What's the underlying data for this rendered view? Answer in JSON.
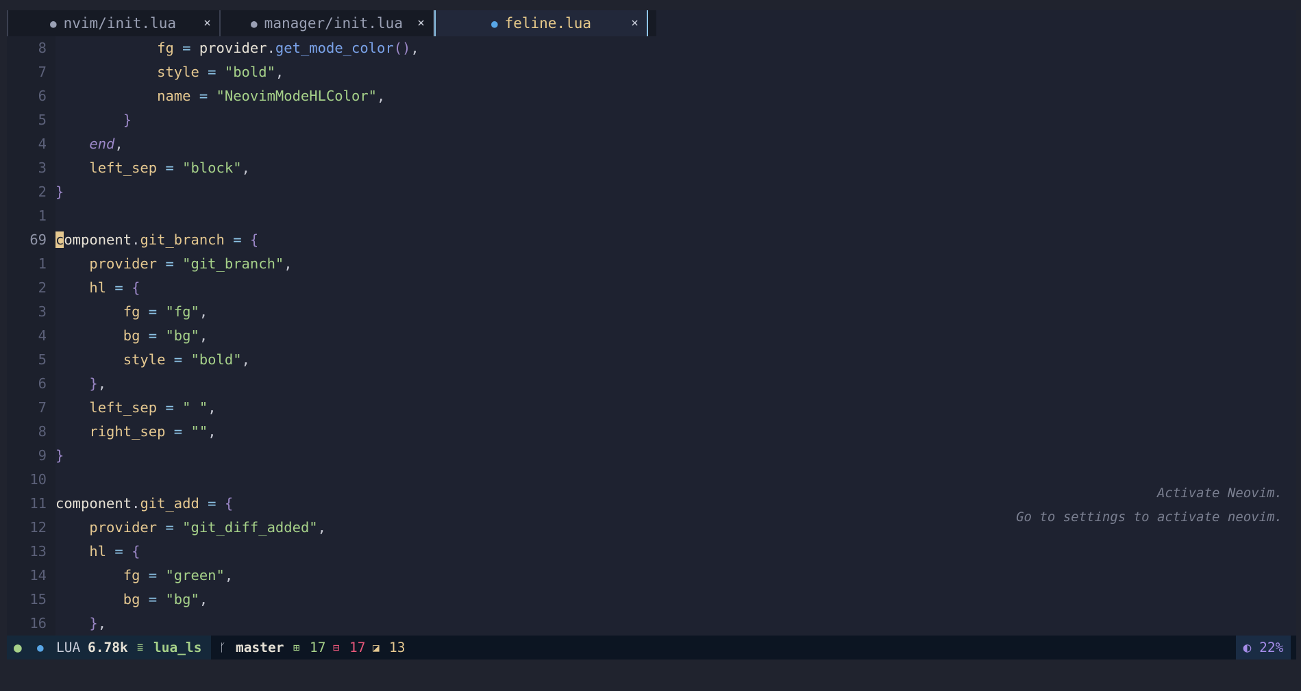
{
  "tabs": [
    {
      "label": "nvim/init.lua",
      "close": "×"
    },
    {
      "label": "manager/init.lua",
      "close": "×"
    },
    {
      "label": "feline.lua",
      "close": "×"
    }
  ],
  "active_tab_index": 2,
  "lines": [
    {
      "num": "8",
      "tokens": [
        [
          "            ",
          "k-id"
        ],
        [
          "fg",
          "k-key"
        ],
        [
          " = ",
          "k-op"
        ],
        [
          "provider",
          "k-id"
        ],
        [
          ".",
          "k-pn"
        ],
        [
          "get_mode_color",
          "k-fn"
        ],
        [
          "()",
          "k-br"
        ],
        [
          ",",
          "k-pn"
        ]
      ]
    },
    {
      "num": "7",
      "tokens": [
        [
          "            ",
          "k-id"
        ],
        [
          "style",
          "k-key"
        ],
        [
          " = ",
          "k-op"
        ],
        [
          "\"bold\"",
          "k-str"
        ],
        [
          ",",
          "k-pn"
        ]
      ]
    },
    {
      "num": "6",
      "tokens": [
        [
          "            ",
          "k-id"
        ],
        [
          "name",
          "k-key"
        ],
        [
          " = ",
          "k-op"
        ],
        [
          "\"NeovimModeHLColor\"",
          "k-str"
        ],
        [
          ",",
          "k-pn"
        ]
      ]
    },
    {
      "num": "5",
      "tokens": [
        [
          "        ",
          "k-id"
        ],
        [
          "}",
          "k-br"
        ]
      ]
    },
    {
      "num": "4",
      "tokens": [
        [
          "    ",
          "k-id"
        ],
        [
          "end",
          "k-kw"
        ],
        [
          ",",
          "k-pn"
        ]
      ]
    },
    {
      "num": "3",
      "tokens": [
        [
          "    ",
          "k-id"
        ],
        [
          "left_sep",
          "k-key"
        ],
        [
          " = ",
          "k-op"
        ],
        [
          "\"block\"",
          "k-str"
        ],
        [
          ",",
          "k-pn"
        ]
      ]
    },
    {
      "num": "2",
      "tokens": [
        [
          "}",
          "k-br"
        ]
      ]
    },
    {
      "num": "1",
      "tokens": []
    },
    {
      "num": "69",
      "current": true,
      "tokens": [
        [
          "c",
          "cursor"
        ],
        [
          "omponent",
          "k-id"
        ],
        [
          ".",
          "k-pn"
        ],
        [
          "git_branch",
          "k-key"
        ],
        [
          " = ",
          "k-op"
        ],
        [
          "{",
          "k-br"
        ]
      ]
    },
    {
      "num": "1",
      "tokens": [
        [
          "    ",
          "k-id"
        ],
        [
          "provider",
          "k-key"
        ],
        [
          " = ",
          "k-op"
        ],
        [
          "\"git_branch\"",
          "k-str"
        ],
        [
          ",",
          "k-pn"
        ]
      ]
    },
    {
      "num": "2",
      "tokens": [
        [
          "    ",
          "k-id"
        ],
        [
          "hl",
          "k-key"
        ],
        [
          " = ",
          "k-op"
        ],
        [
          "{",
          "k-br"
        ]
      ]
    },
    {
      "num": "3",
      "tokens": [
        [
          "        ",
          "k-id"
        ],
        [
          "fg",
          "k-key"
        ],
        [
          " = ",
          "k-op"
        ],
        [
          "\"fg\"",
          "k-str"
        ],
        [
          ",",
          "k-pn"
        ]
      ]
    },
    {
      "num": "4",
      "tokens": [
        [
          "        ",
          "k-id"
        ],
        [
          "bg",
          "k-key"
        ],
        [
          " = ",
          "k-op"
        ],
        [
          "\"bg\"",
          "k-str"
        ],
        [
          ",",
          "k-pn"
        ]
      ]
    },
    {
      "num": "5",
      "tokens": [
        [
          "        ",
          "k-id"
        ],
        [
          "style",
          "k-key"
        ],
        [
          " = ",
          "k-op"
        ],
        [
          "\"bold\"",
          "k-str"
        ],
        [
          ",",
          "k-pn"
        ]
      ]
    },
    {
      "num": "6",
      "tokens": [
        [
          "    ",
          "k-id"
        ],
        [
          "}",
          "k-br"
        ],
        [
          ",",
          "k-pn"
        ]
      ]
    },
    {
      "num": "7",
      "tokens": [
        [
          "    ",
          "k-id"
        ],
        [
          "left_sep",
          "k-key"
        ],
        [
          " = ",
          "k-op"
        ],
        [
          "\" \"",
          "k-str"
        ],
        [
          ",",
          "k-pn"
        ]
      ]
    },
    {
      "num": "8",
      "tokens": [
        [
          "    ",
          "k-id"
        ],
        [
          "right_sep",
          "k-key"
        ],
        [
          " = ",
          "k-op"
        ],
        [
          "\"\"",
          "k-str"
        ],
        [
          ",",
          "k-pn"
        ]
      ]
    },
    {
      "num": "9",
      "tokens": [
        [
          "}",
          "k-br"
        ]
      ]
    },
    {
      "num": "10",
      "tokens": []
    },
    {
      "num": "11",
      "tokens": [
        [
          "component",
          "k-id"
        ],
        [
          ".",
          "k-pn"
        ],
        [
          "git_add",
          "k-key"
        ],
        [
          " = ",
          "k-op"
        ],
        [
          "{",
          "k-br"
        ]
      ]
    },
    {
      "num": "12",
      "tokens": [
        [
          "    ",
          "k-id"
        ],
        [
          "provider",
          "k-key"
        ],
        [
          " = ",
          "k-op"
        ],
        [
          "\"git_diff_added\"",
          "k-str"
        ],
        [
          ",",
          "k-pn"
        ]
      ]
    },
    {
      "num": "13",
      "tokens": [
        [
          "    ",
          "k-id"
        ],
        [
          "hl",
          "k-key"
        ],
        [
          " = ",
          "k-op"
        ],
        [
          "{",
          "k-br"
        ]
      ]
    },
    {
      "num": "14",
      "tokens": [
        [
          "        ",
          "k-id"
        ],
        [
          "fg",
          "k-key"
        ],
        [
          " = ",
          "k-op"
        ],
        [
          "\"green\"",
          "k-str"
        ],
        [
          ",",
          "k-pn"
        ]
      ]
    },
    {
      "num": "15",
      "tokens": [
        [
          "        ",
          "k-id"
        ],
        [
          "bg",
          "k-key"
        ],
        [
          " = ",
          "k-op"
        ],
        [
          "\"bg\"",
          "k-str"
        ],
        [
          ",",
          "k-pn"
        ]
      ]
    },
    {
      "num": "16",
      "tokens": [
        [
          "    ",
          "k-id"
        ],
        [
          "}",
          "k-br"
        ],
        [
          ",",
          "k-pn"
        ]
      ]
    }
  ],
  "watermark": {
    "line1": "Activate Neovim.",
    "line2": "Go to settings to activate neovim."
  },
  "statusline": {
    "mode_dot": "●",
    "file_icon": "lua-file-icon",
    "filetype": "LUA",
    "filesize": "6.78k",
    "lsp_icon": "≣",
    "lsp": "lua_ls",
    "branch_icon": "git-branch-icon",
    "branch": "master",
    "added_icon": "⊞",
    "added": "17",
    "removed_icon": "⊟",
    "removed": "17",
    "changed_icon": "◪",
    "changed": "13",
    "progress_icon": "◐",
    "progress": "22%"
  },
  "colors": {
    "green": "#a6d189",
    "red": "#e8577a",
    "yellow": "#e5c890",
    "blue": "#58a6e6",
    "purple": "#a58ce8"
  }
}
